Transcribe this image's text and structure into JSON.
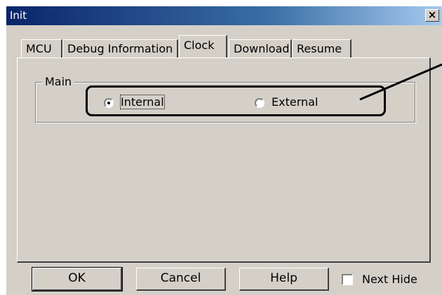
{
  "window": {
    "title": "Init",
    "close_glyph": "×"
  },
  "tabs": [
    {
      "label": "MCU"
    },
    {
      "label": "Debug Information"
    },
    {
      "label": "Clock"
    },
    {
      "label": "Download"
    },
    {
      "label": "Resume"
    }
  ],
  "active_tab": "Clock",
  "clock": {
    "group_label": "Main",
    "options": [
      {
        "label": "Internal",
        "selected": true
      },
      {
        "label": "External",
        "selected": false
      }
    ]
  },
  "buttons": {
    "ok": "OK",
    "cancel": "Cancel",
    "help": "Help"
  },
  "next_hide": {
    "label": "Next Hide",
    "checked": false
  }
}
